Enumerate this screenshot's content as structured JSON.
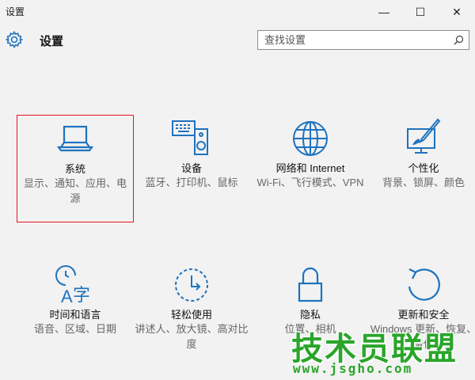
{
  "window": {
    "title": "设置",
    "min_glyph": "—",
    "max_glyph": "☐",
    "close_glyph": "✕"
  },
  "header": {
    "title": "设置"
  },
  "search": {
    "placeholder": "查找设置"
  },
  "tiles": [
    {
      "id": "system",
      "title": "系统",
      "desc": "显示、通知、应用、电源",
      "icon": "laptop-icon"
    },
    {
      "id": "devices",
      "title": "设备",
      "desc": "蓝牙、打印机、鼠标",
      "icon": "devices-icon"
    },
    {
      "id": "network",
      "title": "网络和 Internet",
      "desc": "Wi-Fi、飞行模式、VPN",
      "icon": "globe-icon"
    },
    {
      "id": "personal",
      "title": "个性化",
      "desc": "背景、锁屏、颜色",
      "icon": "personalization-icon"
    },
    {
      "id": "time",
      "title": "时间和语言",
      "desc": "语音、区域、日期",
      "icon": "time-language-icon"
    },
    {
      "id": "ease",
      "title": "轻松使用",
      "desc": "讲述人、放大镜、高对比度",
      "icon": "ease-of-access-icon"
    },
    {
      "id": "privacy",
      "title": "隐私",
      "desc": "位置、相机",
      "icon": "lock-icon"
    },
    {
      "id": "update",
      "title": "更新和安全",
      "desc": "Windows 更新、恢复、备份",
      "icon": "refresh-icon"
    }
  ],
  "watermark": {
    "main": "技术员联盟",
    "url": "www.jsgho.com"
  },
  "colors": {
    "accent": "#1e73be",
    "highlight": "#e81123",
    "watermark": "#2aa52a"
  }
}
